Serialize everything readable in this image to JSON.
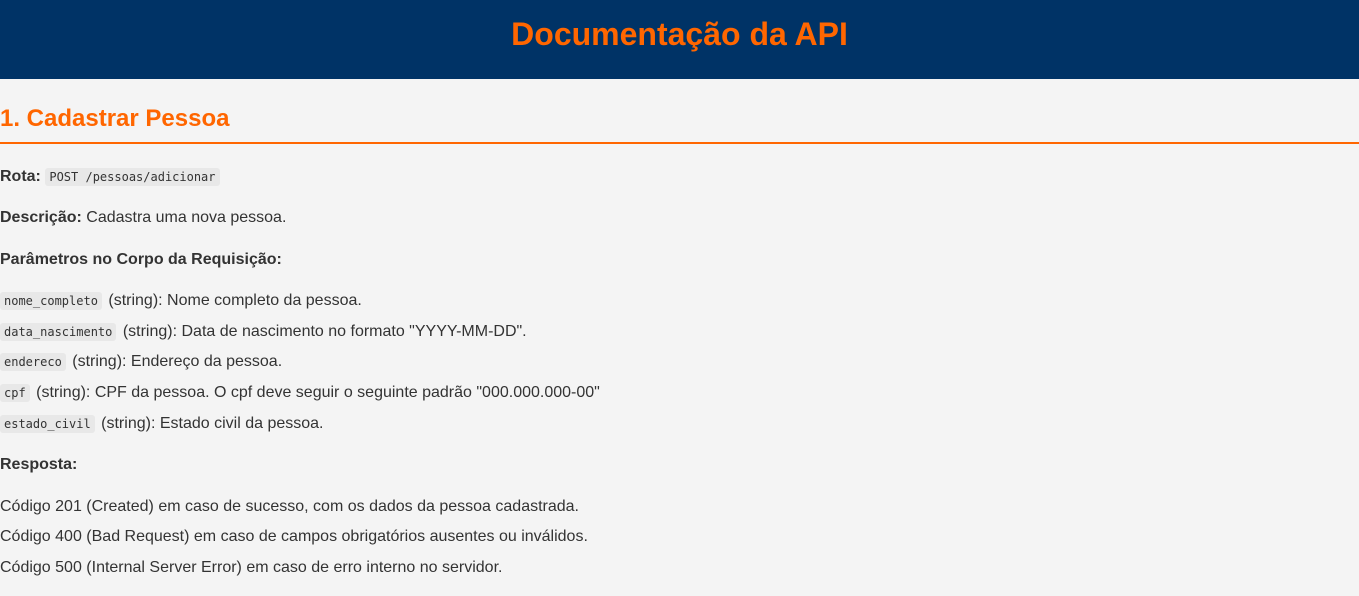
{
  "header": {
    "title": "Documentação da API"
  },
  "section": {
    "title": "1. Cadastrar Pessoa",
    "route_label": "Rota:",
    "route_code": "POST /pessoas/adicionar",
    "description_label": "Descrição:",
    "description_text": " Cadastra uma nova pessoa.",
    "params_heading": "Parâmetros no Corpo da Requisição:",
    "params": [
      {
        "name": "nome_completo",
        "desc": "(string): Nome completo da pessoa."
      },
      {
        "name": "data_nascimento",
        "desc": "(string): Data de nascimento no formato \"YYYY-MM-DD\"."
      },
      {
        "name": "endereco",
        "desc": "(string): Endereço da pessoa."
      },
      {
        "name": "cpf",
        "desc": "(string): CPF da pessoa. O cpf deve seguir o seguinte padrão \"000.000.000-00\""
      },
      {
        "name": "estado_civil",
        "desc": "(string): Estado civil da pessoa."
      }
    ],
    "response_heading": "Resposta:",
    "responses": [
      "Código 201 (Created) em caso de sucesso, com os dados da pessoa cadastrada.",
      "Código 400 (Bad Request) em caso de campos obrigatórios ausentes ou inválidos.",
      "Código 500 (Internal Server Error) em caso de erro interno no servidor."
    ]
  },
  "colors": {
    "header_bg": "#003366",
    "accent": "#ff6600",
    "page_bg": "#f4f4f4",
    "text": "#333333"
  }
}
